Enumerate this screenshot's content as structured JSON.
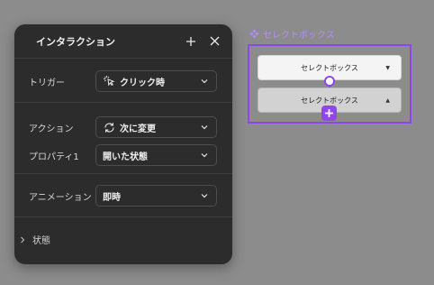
{
  "panel": {
    "title": "インタラクション",
    "trigger": {
      "label": "トリガー",
      "value": "クリック時",
      "icon": "pointer-click-icon"
    },
    "action": {
      "label": "アクション",
      "value": "次に変更",
      "icon": "refresh-icon"
    },
    "property": {
      "label": "プロパティ1",
      "value": "開いた状態"
    },
    "animation": {
      "label": "アニメーション",
      "value": "即時"
    },
    "state": {
      "label": "状態"
    }
  },
  "canvas": {
    "component_name": "セレクトボックス",
    "variant1_label": "セレクトボックス",
    "variant1_caret": "▼",
    "variant2_label": "セレクトボックス",
    "variant2_caret": "▲",
    "accent_color": "#8f48e8"
  }
}
